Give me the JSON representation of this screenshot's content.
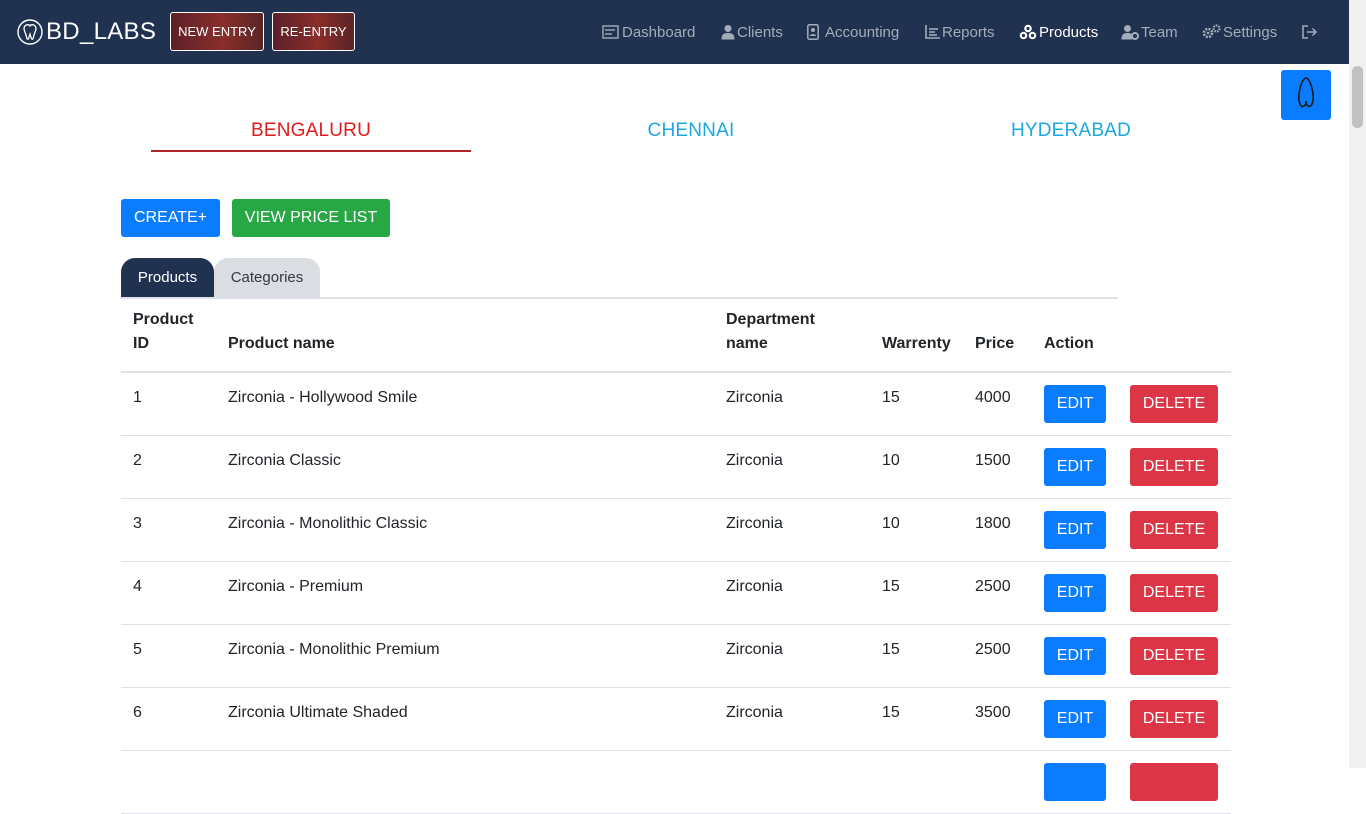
{
  "header": {
    "brand": "BD_LABS",
    "new_entry": "NEW ENTRY",
    "re_entry": "RE-ENTRY",
    "bar_color": "#213150"
  },
  "nav": [
    {
      "label": "Dashboard",
      "icon": "dashboard-icon",
      "active": false
    },
    {
      "label": "Clients",
      "icon": "users-icon",
      "active": false
    },
    {
      "label": "Accounting",
      "icon": "id-card-icon",
      "active": false
    },
    {
      "label": "Reports",
      "icon": "chart-icon",
      "active": false
    },
    {
      "label": "Products",
      "icon": "cubes-icon",
      "active": true
    },
    {
      "label": "Team",
      "icon": "user-gear-icon",
      "active": false
    },
    {
      "label": "Settings",
      "icon": "gears-icon",
      "active": false
    },
    {
      "label": "",
      "icon": "logout-icon",
      "active": false
    }
  ],
  "cities": [
    {
      "label": "BENGALURU",
      "active": true
    },
    {
      "label": "CHENNAI",
      "active": false
    },
    {
      "label": "HYDERABAD",
      "active": false
    }
  ],
  "actions": {
    "create": "CREATE+",
    "view_price_list": "VIEW PRICE LIST"
  },
  "subtabs": [
    {
      "label": "Products",
      "active": true
    },
    {
      "label": "Categories",
      "active": false
    }
  ],
  "table": {
    "headers": {
      "id_line1": "Product",
      "id_line2": "ID",
      "name": "Product name",
      "dept_line1": "Department",
      "dept_line2": "name",
      "warranty": "Warrenty",
      "price": "Price",
      "action": "Action"
    },
    "edit_label": "EDIT",
    "delete_label": "DELETE",
    "rows": [
      {
        "id": "1",
        "name": "Zirconia - Hollywood Smile",
        "dept": "Zirconia",
        "warranty": "15",
        "price": "4000"
      },
      {
        "id": "2",
        "name": "Zirconia Classic",
        "dept": "Zirconia",
        "warranty": "10",
        "price": "1500"
      },
      {
        "id": "3",
        "name": "Zirconia - Monolithic Classic",
        "dept": "Zirconia",
        "warranty": "10",
        "price": "1800"
      },
      {
        "id": "4",
        "name": "Zirconia - Premium",
        "dept": "Zirconia",
        "warranty": "15",
        "price": "2500"
      },
      {
        "id": "5",
        "name": "Zirconia - Monolithic Premium",
        "dept": "Zirconia",
        "warranty": "15",
        "price": "2500"
      },
      {
        "id": "6",
        "name": "Zirconia Ultimate Shaded",
        "dept": "Zirconia",
        "warranty": "15",
        "price": "3500"
      }
    ]
  },
  "colors": {
    "primary": "#0a7cff",
    "success": "#28a745",
    "danger": "#dc3545",
    "city_active": "#e01b1b",
    "city_inactive": "#1ba8e0"
  }
}
